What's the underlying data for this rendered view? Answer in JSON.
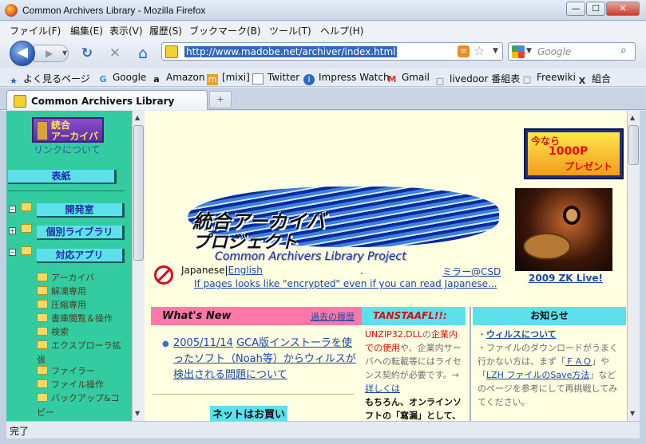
{
  "window": {
    "title": "Common Archivers Library - Mozilla Firefox",
    "buttons": {
      "minimize": "—",
      "maximize": "☐",
      "close": "✕"
    }
  },
  "menubar": {
    "items": [
      "ファイル(F)",
      "編集(E)",
      "表示(V)",
      "履歴(S)",
      "ブックマーク(B)",
      "ツール(T)",
      "ヘルプ(H)"
    ]
  },
  "navbar": {
    "back_icon": "◀",
    "forward_icon": "▶",
    "dropdown_icon": "▼",
    "reload_icon": "↻",
    "stop_icon": "✕",
    "home_icon": "⌂",
    "url": "http://www.madobe.net/archiver/index.html",
    "rss_icon": "≡",
    "star_icon": "☆",
    "search_placeholder": "Google",
    "search_icon": "⌕"
  },
  "bookmarks": [
    {
      "label": "よく見るページ",
      "icon": "★"
    },
    {
      "label": "Google",
      "icon": "G"
    },
    {
      "label": "Amazon",
      "icon": "a"
    },
    {
      "label": "[mixi]",
      "icon": "m"
    },
    {
      "label": "Twitter",
      "icon": "t"
    },
    {
      "label": "Impress Watch",
      "icon": "i"
    },
    {
      "label": "Gmail",
      "icon": "M"
    },
    {
      "label": "livedoor 番組表",
      "icon": "□"
    },
    {
      "label": "Freewiki",
      "icon": "□"
    },
    {
      "label": "組合",
      "icon": "X"
    }
  ],
  "tabs": {
    "active_label": "Common Archivers Library",
    "newtab_icon": "+"
  },
  "sidebar": {
    "logo_text": "統合\nアーカイバ",
    "link_label": "リンクについて",
    "cover": "表紙",
    "sections": [
      {
        "label": "開発室"
      },
      {
        "label": "個別ライブラリ"
      },
      {
        "label": "対応アプリ"
      }
    ],
    "tree_items": [
      "アーカイバ",
      "解凍専用",
      "圧縮専用",
      "書庫閲覧＆操作",
      "検索",
      "エクスプローラ拡張",
      "ファイラー",
      "ファイル操作",
      "バックアップ&コピー"
    ],
    "toggle_minus": "−",
    "toggle_plus": "+"
  },
  "main": {
    "ad_line1": "今なら",
    "ad_line2": "1000P",
    "ad_line3": "プレゼント",
    "photo_caption": "2009 ZK Live!",
    "banner_jp1": "統合アーカイバ",
    "banner_jp2": "プロジェクト",
    "banner_en": "Common Archivers Library Project",
    "lang_japanese": "Japanese",
    "lang_sep": "|",
    "lang_english": "English",
    "dot": ".",
    "mirror": "ミラー@CSD",
    "encoding_note": "If pages looks like \"encrypted\" even if you can read Japanese...",
    "whatsnew_title": "What's New",
    "history_link": "過去の履歴",
    "news": [
      {
        "date": "2005/11/14",
        "text": "GCA版インストーラを使ったソフト（Noah等）からウィルスが検出される問題について"
      }
    ],
    "shop_heading": "ネットはお買い",
    "tanstaafl_title": "TANSTAAFL!!:",
    "tanstaafl_text": {
      "red1": "UNZIP32.DLL",
      "gray1": "の",
      "red2": "企業内での使用",
      "gray2": "や、企業内サーバへの転載等にはライセンス契約が必要です。→",
      "link": "詳しくは",
      "bold": "もちろん、オンラインソフトの「寫漏」として、"
    },
    "notice_title": "お知らせ",
    "notice_items": [
      {
        "prefix": "・",
        "link": "ウィルスについて"
      },
      {
        "prefix": "・",
        "text": "ファイルのダウンロードがうまく行かない方は、まず「",
        "link1": "ＦＡＱ",
        "mid": "」や「",
        "link2": "LZH ファイルのSave方法",
        "suffix": "」などのページを参考にして再挑戦してみてください。"
      }
    ]
  },
  "status": {
    "text": "完了"
  }
}
